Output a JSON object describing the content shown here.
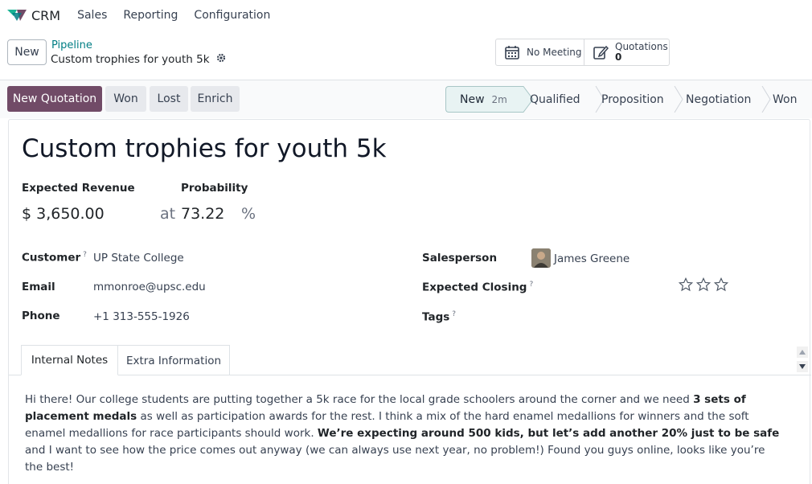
{
  "nav": {
    "app_name": "CRM",
    "menu": [
      "Sales",
      "Reporting",
      "Configuration"
    ]
  },
  "control_panel": {
    "new_label": "New",
    "breadcrumb_parent": "Pipeline",
    "breadcrumb_current": "Custom trophies for youth 5k",
    "smart_buttons": {
      "meeting_label": "No Meeting",
      "quotations_label": "Quotations",
      "quotations_count": "0"
    }
  },
  "actions": {
    "new_quotation": "New Quotation",
    "won": "Won",
    "lost": "Lost",
    "enrich": "Enrich"
  },
  "stages": {
    "current": "New",
    "current_duration": "2m",
    "others": [
      "Qualified",
      "Proposition",
      "Negotiation",
      "Won"
    ]
  },
  "lead": {
    "title": "Custom trophies for youth 5k",
    "expected_revenue_label": "Expected Revenue",
    "expected_revenue": "$ 3,650.00",
    "at_label": "at",
    "probability_label": "Probability",
    "probability": "73.22",
    "percent_sign": "%",
    "customer_label": "Customer",
    "customer": "UP State College",
    "email_label": "Email",
    "email": "mmonroe@upsc.edu",
    "phone_label": "Phone",
    "phone": "+1 313-555-1926",
    "salesperson_label": "Salesperson",
    "salesperson": "James Greene",
    "expected_closing_label": "Expected Closing",
    "tags_label": "Tags",
    "help_mark": "?",
    "priority_stars": 0
  },
  "tabs": [
    "Internal Notes",
    "Extra Information"
  ],
  "notes": {
    "p1": "Hi there! Our college students are putting together a 5k race for the local grade schoolers around the corner and we need ",
    "b1": "3 sets of placement medals",
    "p2": " as well as participation awards for the rest. I think a mix of the hard enamel medallions for winners and the soft enamel medallions for race participants should work. ",
    "b2": "We’re expecting around 500 kids, but let’s add another 20% just to be safe",
    "p3": " and I want to see how the price comes out anyway (we can always use next year, no problem!)  Found you guys online, looks like you’re the best!"
  },
  "colors": {
    "primary": "#714b67",
    "link": "#017e84",
    "stage_active_bg": "#e8f3f3"
  }
}
